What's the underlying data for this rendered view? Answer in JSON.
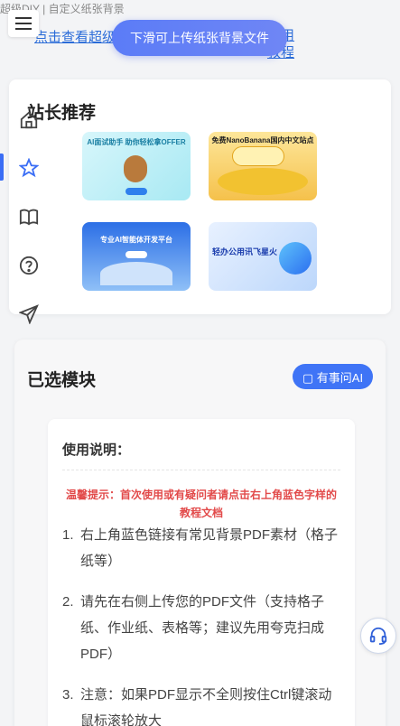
{
  "header": {
    "site_title": "超级DIY | 自定义纸张背景",
    "help_link": "点击查看超级DIY使用",
    "help_link_tail": "使用教程",
    "upload_button": "下滑可上传纸张背景文件"
  },
  "recommend": {
    "title": "站长推荐",
    "ads": [
      {
        "text": "AI面试助手 助你轻松拿OFFER"
      },
      {
        "text": "免费NanoBanana国内中文站点"
      },
      {
        "text": "专业AI智能体开发平台"
      },
      {
        "text": "轻办公用讯飞星火"
      }
    ]
  },
  "sidebar": {
    "items": [
      {
        "icon": "home-icon"
      },
      {
        "icon": "star-icon"
      },
      {
        "icon": "book-icon"
      },
      {
        "icon": "help-icon"
      },
      {
        "icon": "send-icon"
      }
    ]
  },
  "modules": {
    "title": "已选模块",
    "ai_button": "▢ 有事问AI",
    "instructions": {
      "title": "使用说明：",
      "tip": "温馨提示：首次使用或有疑问者请点击右上角蓝色字样的教程文档",
      "steps": [
        "右上角蓝色链接有常见背景PDF素材（格子纸等）",
        "请先在右侧上传您的PDF文件（支持格子纸、作业纸、表格等；建议先用夸克扫成PDF）",
        "注意：如果PDF显示不全则按住Ctrl键滚动鼠标滚轮放大"
      ]
    }
  },
  "colors": {
    "accent": "#3f74f6",
    "warning": "#e24a4a",
    "link": "#2b6cd8"
  }
}
